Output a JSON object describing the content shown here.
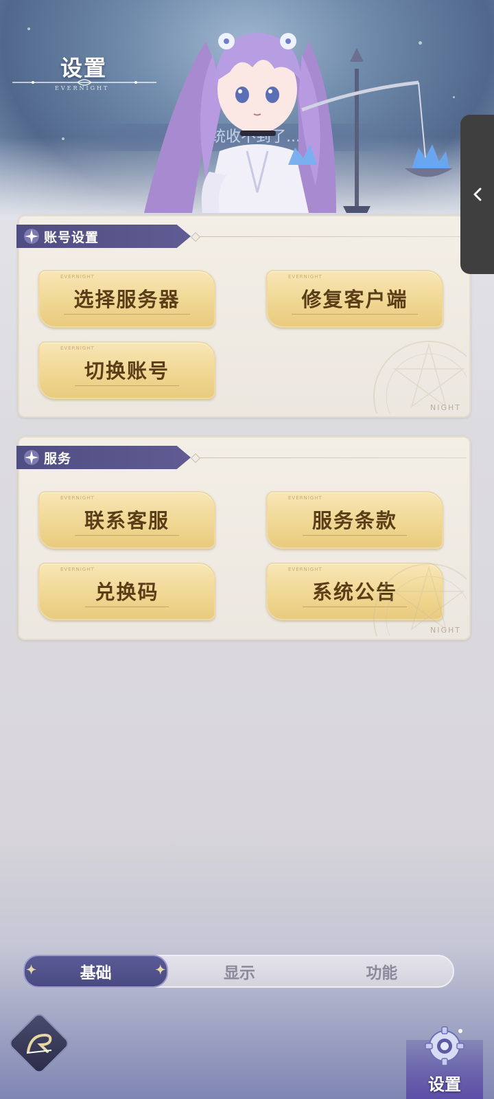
{
  "header": {
    "title": "设置",
    "subtitle": "EVERNIGHT",
    "marquee_text": "...告系统收不到了..."
  },
  "sections": [
    {
      "title": "账号设置",
      "buttons": [
        "选择服务器",
        "修复客户端",
        "切换账号"
      ]
    },
    {
      "title": "服务",
      "buttons": [
        "联系客服",
        "服务条款",
        "兑换码",
        "系统公告"
      ]
    }
  ],
  "button_tag": "EVERNIGHT",
  "panel_watermark": "NIGHT",
  "tabs": [
    {
      "label": "基础",
      "active": true
    },
    {
      "label": "显示",
      "active": false
    },
    {
      "label": "功能",
      "active": false
    }
  ],
  "bottom_nav": {
    "settings_label": "设置",
    "logo_icon": "evernight-logo-icon",
    "settings_icon": "gear-icon"
  },
  "side_handle": {
    "icon": "chevron-left-icon"
  },
  "colors": {
    "accent": "#4f4d82",
    "button_gold": "#f0d793",
    "button_text": "#5a3e17"
  }
}
